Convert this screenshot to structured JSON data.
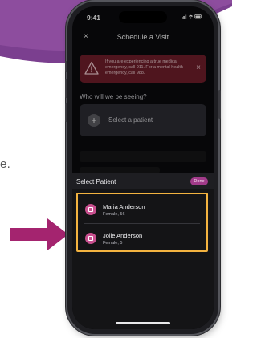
{
  "background": {
    "partial_text": "e.",
    "accent_color": "#7b3f8f",
    "arrow_color": "#a4246f"
  },
  "statusbar": {
    "time": "9:41",
    "icons": "signal wifi battery"
  },
  "nav": {
    "close_label": "×",
    "title": "Schedule a Visit"
  },
  "alert": {
    "text": "If you are experiencing a true medical emergency, call 911. For a mental health emergency, call 988.",
    "icon": "warning-icon",
    "close_label": "×"
  },
  "question": "Who will we be seeing?",
  "select_patient_card": {
    "label": "Select a patient",
    "icon": "plus-icon"
  },
  "sheet": {
    "title": "Select Patient",
    "done_label": "Done",
    "highlight_color": "#f3b340",
    "patients": [
      {
        "name": "Maria Anderson",
        "detail": "Female, 56"
      },
      {
        "name": "Jolie Anderson",
        "detail": "Female, 5"
      }
    ]
  }
}
